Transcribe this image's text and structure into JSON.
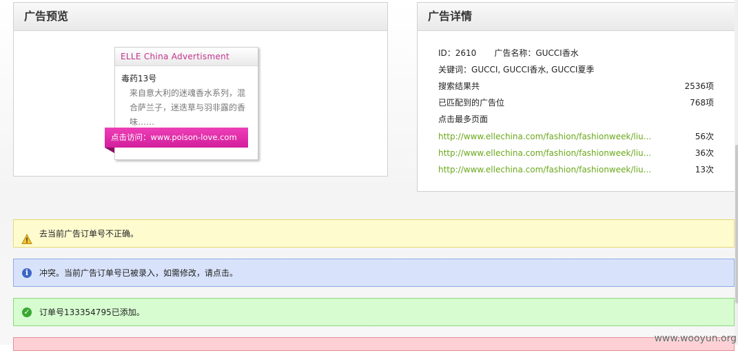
{
  "preview": {
    "title": "广告预览",
    "ad": {
      "brand": "ELLE China Advertisment",
      "name": "毒药13号",
      "description": "来自意大利的迷魂香水系列，混合萨兰子，迷迭草与羽非露的香味……",
      "cta": "点击访问：www.poison-love.com"
    }
  },
  "details": {
    "title": "广告详情",
    "id_label": "ID：",
    "id_value": "2610",
    "name_label": "广告名称：",
    "name_value": "GUCCI香水",
    "keywords_label": "关键词：",
    "keywords_value": "GUCCI, GUCCI香水, GUCCI夏季",
    "search_results_label": "搜索结果共",
    "search_results_value": "2536项",
    "matched_label": "已匹配到的广告位",
    "matched_value": "768项",
    "top_pages_label": "点击最多页面",
    "top_pages": [
      {
        "url": "http://www.ellechina.com/fashion/fashionweek/liu...",
        "count": "56次"
      },
      {
        "url": "http://www.ellechina.com/fashion/fashionweek/liu...",
        "count": "36次"
      },
      {
        "url": "http://www.ellechina.com/fashion/fashionweek/liu...",
        "count": "13次"
      }
    ]
  },
  "alerts": {
    "warning": "去当前广告订单号不正确。",
    "info": "冲突。当前广告订单号已被录入，如需修改，请点击。",
    "success": "订单号133354795已添加。"
  },
  "watermark": "www.wooyun.org",
  "colors": {
    "ad_accent": "#c2338c",
    "ribbon": "#e030a8",
    "link": "#6aa81a",
    "warning_bg": "#fefbcf",
    "info_bg": "#d8e3fb",
    "success_bg": "#d6fcd0",
    "error_bg": "#fcd0d4"
  },
  "icons": {
    "warning": "warning-icon",
    "info": "info-icon",
    "success": "check-circle-icon"
  }
}
